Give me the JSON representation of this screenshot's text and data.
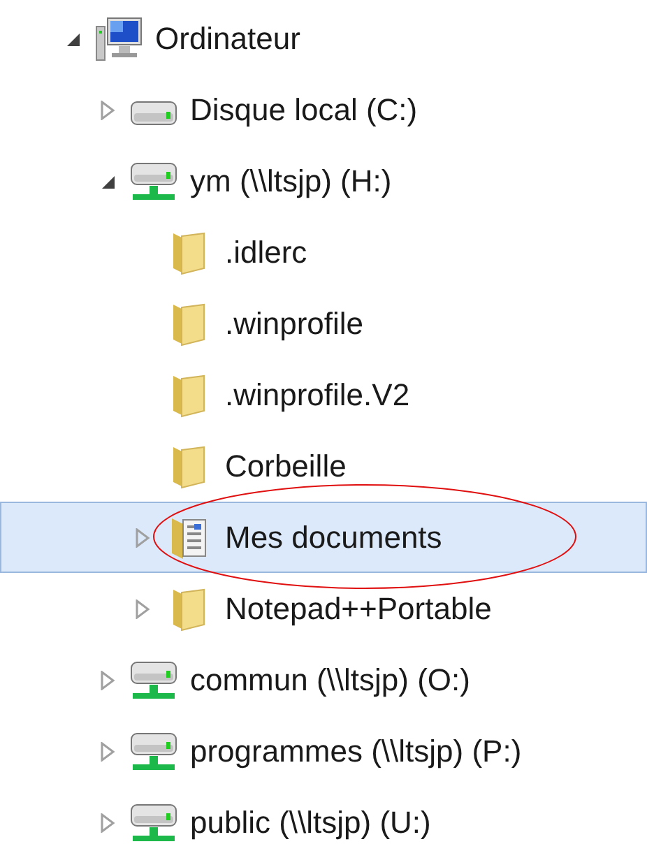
{
  "tree": [
    {
      "label": "Ordinateur",
      "kind": "computer",
      "expandable": true,
      "expanded": true,
      "selected": false,
      "circled": false,
      "children": [
        {
          "label": "Disque local (C:)",
          "kind": "drive",
          "expandable": true,
          "expanded": false,
          "selected": false,
          "circled": false
        },
        {
          "label": "ym (\\\\ltsjp) (H:)",
          "kind": "network",
          "expandable": true,
          "expanded": true,
          "selected": false,
          "circled": false,
          "children": [
            {
              "label": ".idlerc",
              "kind": "folder",
              "expandable": false,
              "selected": false,
              "circled": false
            },
            {
              "label": ".winprofile",
              "kind": "folder",
              "expandable": false,
              "selected": false,
              "circled": false
            },
            {
              "label": ".winprofile.V2",
              "kind": "folder",
              "expandable": false,
              "selected": false,
              "circled": false
            },
            {
              "label": "Corbeille",
              "kind": "folder",
              "expandable": false,
              "selected": false,
              "circled": false
            },
            {
              "label": "Mes documents",
              "kind": "documents",
              "expandable": true,
              "expanded": false,
              "selected": true,
              "circled": true
            },
            {
              "label": "Notepad++Portable",
              "kind": "folder",
              "expandable": true,
              "expanded": false,
              "selected": false,
              "circled": false
            }
          ]
        },
        {
          "label": "commun (\\\\ltsjp) (O:)",
          "kind": "network",
          "expandable": true,
          "expanded": false,
          "selected": false,
          "circled": false
        },
        {
          "label": "programmes (\\\\ltsjp) (P:)",
          "kind": "network",
          "expandable": true,
          "expanded": false,
          "selected": false,
          "circled": false
        },
        {
          "label": "public (\\\\ltsjp) (U:)",
          "kind": "network",
          "expandable": true,
          "expanded": false,
          "selected": false,
          "circled": false
        }
      ]
    }
  ]
}
